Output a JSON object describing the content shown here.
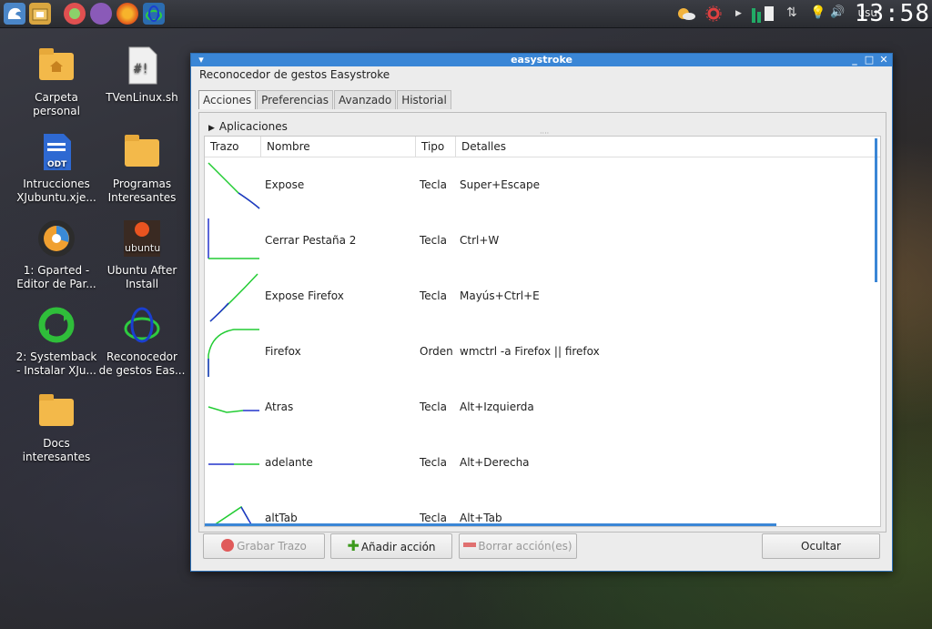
{
  "panel": {
    "user": "usu",
    "clock": "13:58"
  },
  "desktop": {
    "icons": [
      {
        "label": "Carpeta\npersonal"
      },
      {
        "label": "TVenLinux.sh"
      },
      {
        "label": "Intrucciones\nXJubuntu.xje..."
      },
      {
        "label": "Programas\nInteresantes"
      },
      {
        "label": "1: Gparted -\nEditor de Par..."
      },
      {
        "label": "Ubuntu After\nInstall"
      },
      {
        "label": "2: Systemback\n- Instalar XJu..."
      },
      {
        "label": "Reconocedor\nde gestos Eas..."
      },
      {
        "label": "Docs\ninteresantes"
      }
    ]
  },
  "window": {
    "title": "easystroke",
    "app_title": "Reconocedor de gestos Easystroke",
    "tabs": [
      "Acciones",
      "Preferencias",
      "Avanzado",
      "Historial"
    ],
    "expander": "Aplicaciones",
    "columns": [
      "Trazo",
      "Nombre",
      "Tipo",
      "Detalles"
    ],
    "rows": [
      {
        "name": "Expose",
        "type": "Tecla",
        "details": "Super+Escape"
      },
      {
        "name": "Cerrar Pestaña 2",
        "type": "Tecla",
        "details": "Ctrl+W"
      },
      {
        "name": "Expose Firefox",
        "type": "Tecla",
        "details": "Mayús+Ctrl+E"
      },
      {
        "name": "Firefox",
        "type": "Orden",
        "details": "wmctrl -a Firefox || firefox"
      },
      {
        "name": "Atras",
        "type": "Tecla",
        "details": "Alt+Izquierda"
      },
      {
        "name": "adelante",
        "type": "Tecla",
        "details": "Alt+Derecha"
      },
      {
        "name": "altTab",
        "type": "Tecla",
        "details": "Alt+Tab"
      }
    ],
    "buttons": {
      "record": "Grabar Trazo",
      "add": "Añadir acción",
      "delete": "Borrar acción(es)",
      "hide": "Ocultar"
    }
  }
}
